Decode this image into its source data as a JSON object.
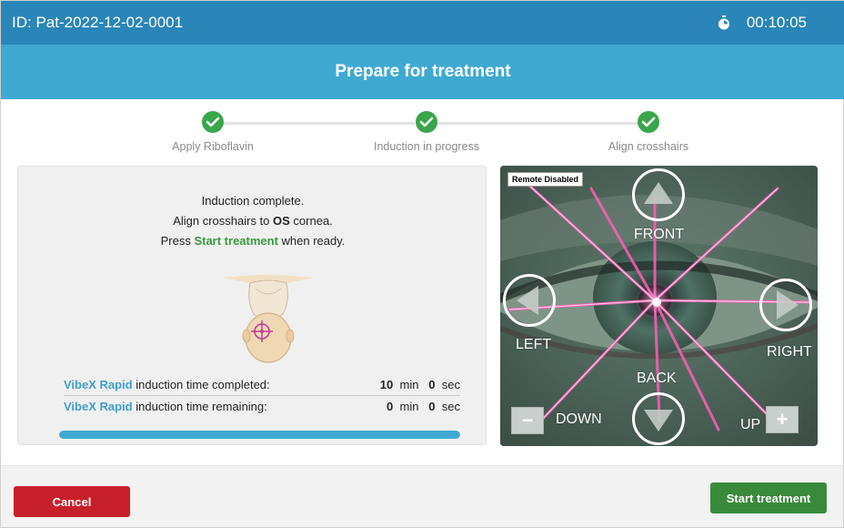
{
  "header": {
    "patient_id": "ID: Pat-2022-12-02-0001",
    "timer": "00:10:05",
    "timer_icon": "stopwatch-icon"
  },
  "title": "Prepare for treatment",
  "steps": [
    {
      "label": "Apply Riboflavin",
      "status": "complete"
    },
    {
      "label": "Induction in progress",
      "status": "complete"
    },
    {
      "label": "Align crosshairs",
      "status": "complete"
    }
  ],
  "instructions": {
    "line1": "Induction complete.",
    "line2_pre": "Align crosshairs to ",
    "line2_bold": "OS",
    "line2_post": " cornea.",
    "line3_pre": "Press ",
    "line3_action": "Start treatment",
    "line3_post": " when ready."
  },
  "induction": {
    "brand": "VibeX Rapid",
    "completed_label": " induction time completed:",
    "completed_min": "10",
    "completed_sec": "0",
    "remaining_label": " induction time remaining:",
    "remaining_min": "0",
    "remaining_sec": "0",
    "min_unit": "min",
    "sec_unit": "sec",
    "progress_fraction": 1.0
  },
  "camera": {
    "remote_status": "Remote Disabled",
    "front_label": "FRONT",
    "back_label": "BACK",
    "left_label": "LEFT",
    "right_label": "RIGHT",
    "down_label": "DOWN",
    "up_label": "UP",
    "zoom_out": "−",
    "zoom_in": "+"
  },
  "footer": {
    "cancel_label": "Cancel",
    "start_label": "Start treatment"
  },
  "colors": {
    "header_blue": "#2a86b8",
    "title_blue": "#3fa9d2",
    "step_green": "#3aa54a",
    "cancel_red": "#c7202b",
    "start_green": "#3a8a3c",
    "brand_blue": "#3fa0cc"
  }
}
